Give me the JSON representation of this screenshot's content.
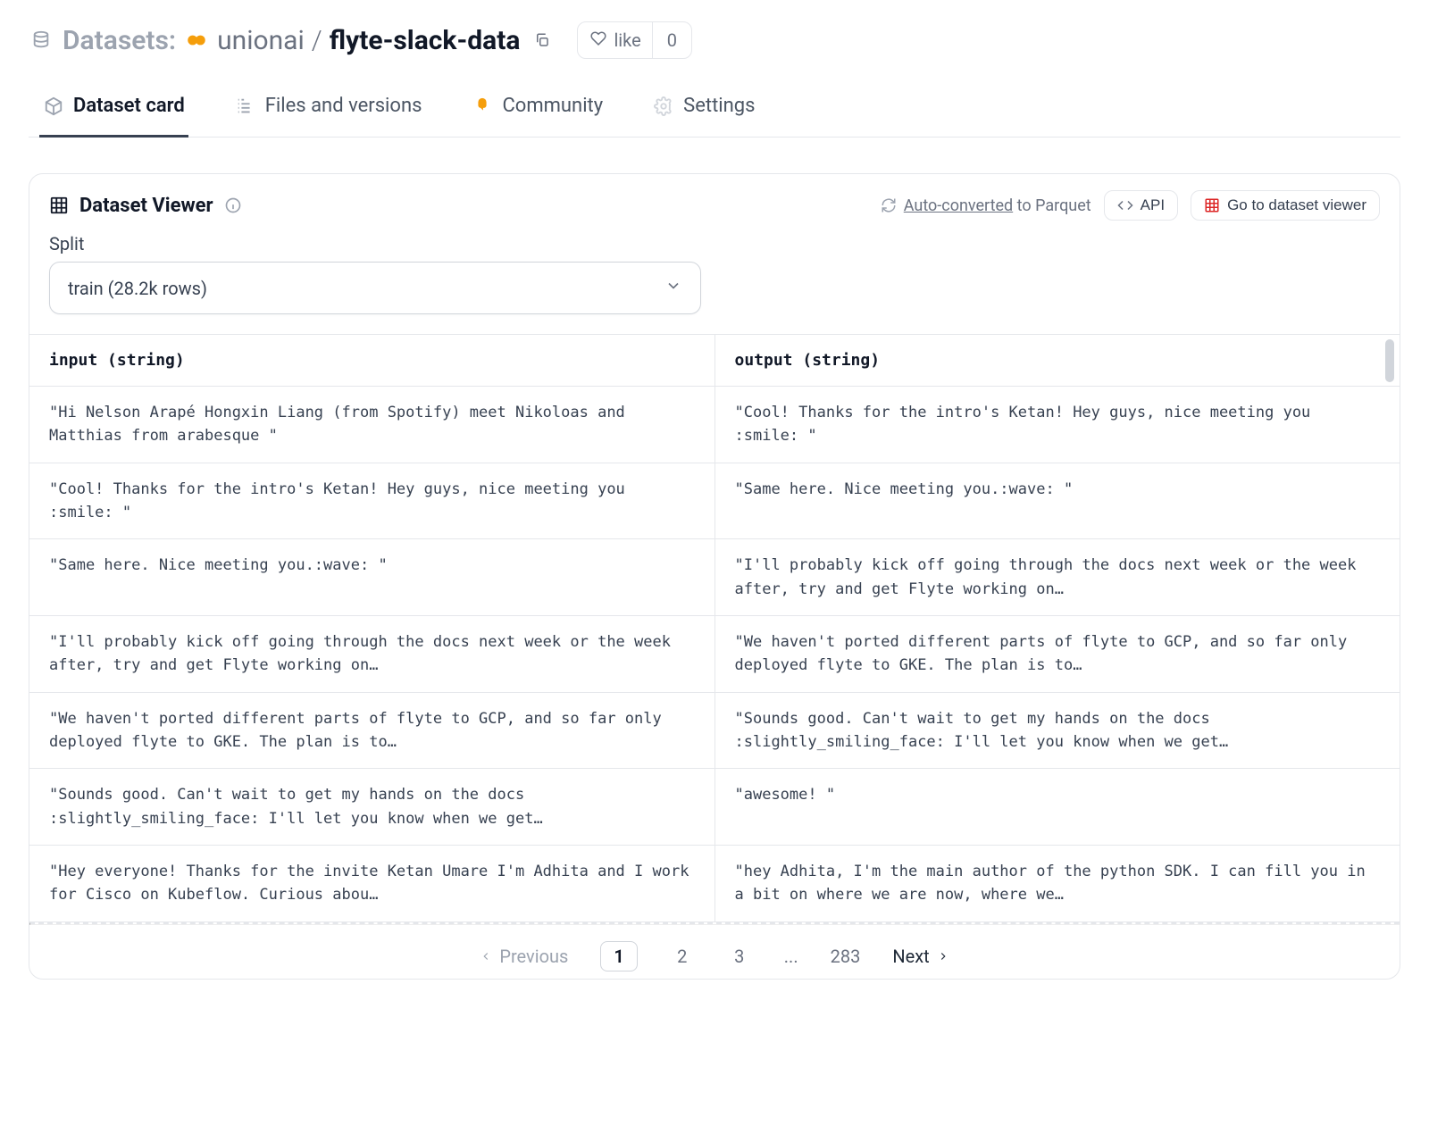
{
  "breadcrumb": {
    "label": "Datasets:",
    "org": "unionai",
    "sep": "/",
    "name": "flyte-slack-data"
  },
  "like": {
    "text": "like",
    "count": "0"
  },
  "tabs": {
    "dataset_card": "Dataset card",
    "files": "Files and versions",
    "community": "Community",
    "settings": "Settings"
  },
  "viewer": {
    "title": "Dataset Viewer",
    "auto_converted": "Auto-converted",
    "to_parquet": " to Parquet",
    "api": "API",
    "goto": "Go to dataset viewer",
    "split_label": "Split",
    "split_value": "train (28.2k rows)"
  },
  "table": {
    "columns": {
      "input": "input (string)",
      "output": "output (string)"
    },
    "rows": [
      {
        "input": "\"Hi Nelson Arapé Hongxin Liang (from Spotify) meet Nikoloas and Matthias from arabesque \"",
        "output": "\"Cool! Thanks for the intro's Ketan! Hey guys, nice meeting you :smile: \""
      },
      {
        "input": "\"Cool! Thanks for the intro's Ketan! Hey guys, nice meeting you :smile: \"",
        "output": "\"Same here. Nice meeting you.:wave: \""
      },
      {
        "input": "\"Same here. Nice meeting you.:wave: \"",
        "output": "\"I'll probably kick off going through the docs next week or the week after, try and get Flyte working on…"
      },
      {
        "input": "\"I'll probably kick off going through the docs next week or the week after, try and get Flyte working on…",
        "output": "\"We haven't ported different parts of flyte to GCP, and so far only deployed flyte to GKE. The plan is to…"
      },
      {
        "input": "\"We haven't ported different parts of flyte to GCP, and so far only deployed flyte to GKE. The plan is to…",
        "output": "\"Sounds good. Can't wait to get my hands on the docs :slightly_smiling_face: I'll let you know when we get…"
      },
      {
        "input": "\"Sounds good. Can't wait to get my hands on the docs :slightly_smiling_face: I'll let you know when we get…",
        "output": "\"awesome! \""
      },
      {
        "input": "\"Hey everyone! Thanks for the invite Ketan Umare I'm Adhita and I work for Cisco on Kubeflow. Curious abou…",
        "output": "\"hey Adhita, I'm the main author of the python SDK. I can fill you in a bit on where we are now, where we…"
      }
    ]
  },
  "pagination": {
    "previous": "Previous",
    "pages": [
      "1",
      "2",
      "3"
    ],
    "ellipsis": "...",
    "last": "283",
    "next": "Next"
  }
}
